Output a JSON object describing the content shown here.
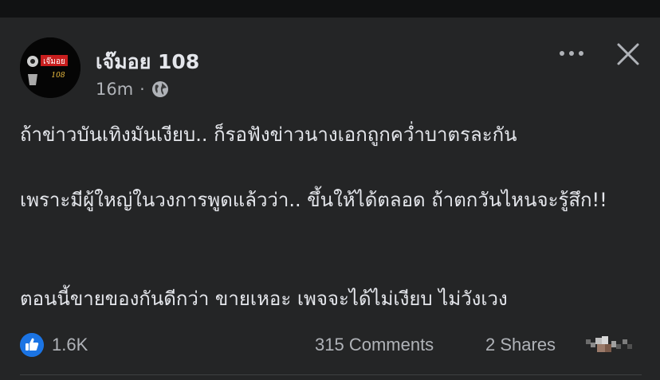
{
  "post": {
    "author": "เจ๊มอย 108",
    "time": "16m",
    "separator": "·",
    "privacy_icon": "globe-icon",
    "avatar_text": "เจ๊มอย",
    "avatar_subtext": "108",
    "paragraphs": [
      "ถ้าข่าวบันเทิงมันเงียบ.. ก็รอฟังข่าวนางเอกถูกคว่ำบาตรละกัน",
      "เพราะมีผู้ใหญ่ในวงการพูดแล้วว่า.. ขึ้นให้ได้ตลอด ถ้าตกวันไหนจะรู้สึก!!",
      "ตอนนี้ขายของกันดีกว่า ขายเหอะ เพจจะได้ไม่เงียบ ไม่วังเวง"
    ],
    "menu_icon": "more-options-icon",
    "close_icon": "close-icon"
  },
  "footer": {
    "reactions": "1.6K",
    "comments": "315 Comments",
    "shares": "2 Shares",
    "like_icon": "thumbs-up-icon"
  },
  "colors": {
    "background": "#242526",
    "text": "#e4e6eb",
    "secondary": "#b0b3b8",
    "like_blue": "#1b74e4"
  }
}
